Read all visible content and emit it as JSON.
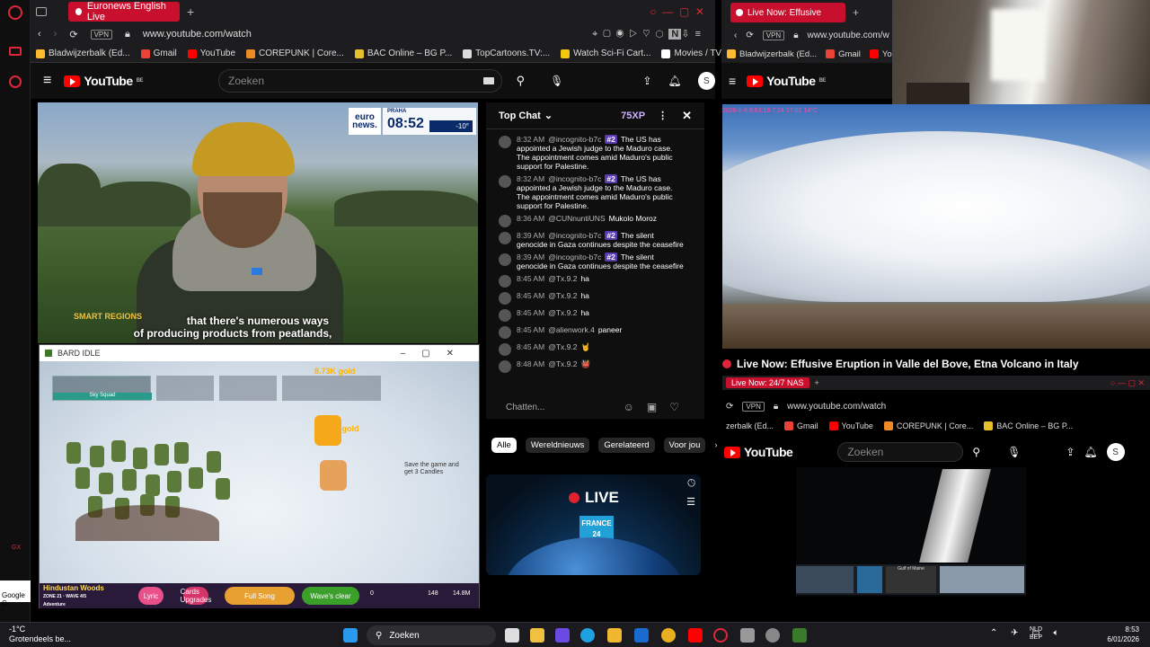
{
  "left_browser": {
    "tab_title": "Euronews English Live",
    "url": "www.youtube.com/watch",
    "vpn": "VPN",
    "bookmarks": [
      "Bladwijzerbalk (Ed...",
      "Gmail",
      "YouTube",
      "COREPUNK | Core...",
      "BAC Online – BG P...",
      "TopCartoons.TV:...",
      "Watch Sci-Fi Cart...",
      "Movies / TV / Ani..."
    ],
    "youtube": {
      "logo": "YouTube",
      "region": "BE",
      "search_placeholder": "Zoeken",
      "avatar": "S"
    },
    "video": {
      "euronews": "euro news.",
      "city": "PRAHA",
      "clock": "08:52",
      "temperature": "-10°",
      "subtitle_1": "that there's numerous ways",
      "subtitle_2": "of producing products from peatlands,",
      "logo_text": "SMART REGIONS"
    },
    "chat": {
      "header": "Top Chat",
      "xp": "75XP",
      "messages": [
        {
          "time": "8:32 AM",
          "author": "@incognito-b7c",
          "badge": "#2",
          "text": "The US has appointed a Jewish judge to the Maduro case. The appointment comes amid Maduro's public support for Palestine."
        },
        {
          "time": "8:32 AM",
          "author": "@incognito-b7c",
          "badge": "#2",
          "text": "The US has appointed a Jewish judge to the Maduro case. The appointment comes amid Maduro's public support for Palestine."
        },
        {
          "time": "8:36 AM",
          "author": "@CUNnuntiUNS",
          "badge": "",
          "text": "Mukolo Moroz"
        },
        {
          "time": "8:39 AM",
          "author": "@incognito-b7c",
          "badge": "#2",
          "text": "The silent genocide in Gaza continues despite the ceasefire"
        },
        {
          "time": "8:39 AM",
          "author": "@incognito-b7c",
          "badge": "#2",
          "text": "The silent genocide in Gaza continues despite the ceasefire"
        },
        {
          "time": "8:45 AM",
          "author": "@Tx.9.2",
          "badge": "",
          "text": "ha"
        },
        {
          "time": "8:45 AM",
          "author": "@Tx.9.2",
          "badge": "",
          "text": "ha"
        },
        {
          "time": "8:45 AM",
          "author": "@Tx.9.2",
          "badge": "",
          "text": "ha"
        },
        {
          "time": "8:45 AM",
          "author": "@alienwork.4",
          "badge": "",
          "text": "paneer"
        },
        {
          "time": "8:45 AM",
          "author": "@Tx.9.2",
          "badge": "",
          "text": "🤘"
        },
        {
          "time": "8:48 AM",
          "author": "@Tx.9.2",
          "badge": "",
          "text": "👹"
        }
      ],
      "input_placeholder": "Chatten..."
    },
    "categories": [
      "Alle",
      "Wereldnieuws",
      "Gerelateerd",
      "Voor jou"
    ],
    "live_card": {
      "live_label": "LIVE",
      "channel": "FRANCE 24"
    }
  },
  "bard_idle": {
    "title": "BARD IDLE",
    "squad": "Sky Squad",
    "gold_1": "8.73K gold",
    "gold_2": "8.75K gold",
    "banner": "Save the game and get 3 Candles",
    "location": "Hindustan Woods",
    "zone": "ZONE 21 · WAVE 4/5",
    "zone_sub": "Adventure",
    "buttons": [
      "Lyric",
      "Cards Upgrades",
      "Full Song",
      "Wave's clear"
    ],
    "counters": [
      "0",
      "148",
      "14.8M"
    ]
  },
  "right_browser": {
    "tab_title": "Live Now: Effusive",
    "url": "www.youtube.com/w",
    "bookmarks": [
      "Bladwijzerbalk (Ed...",
      "Gmail",
      "YouTube"
    ],
    "youtube": {
      "logo": "YouTube",
      "region": "BE"
    },
    "etna_overlay": "2026-1-6  8:53:19     7:24   17:02     14°C",
    "video_title": "Live Now: Effusive Eruption in Valle del Bove, Etna Volcano in Italy",
    "mini": {
      "tab_title": "Live Now: 24/7 NAS",
      "url": "www.youtube.com/watch",
      "bookmarks": [
        "zerbalk (Ed...",
        "Gmail",
        "YouTube",
        "COREPUNK | Core...",
        "BAC Online – BG P..."
      ],
      "search_placeholder": "Zoeken",
      "avatar": "S",
      "map_label": "Gulf of Maine"
    }
  },
  "taskbar": {
    "weather_temp": "-1°C",
    "weather_text": "Grotendeels be...",
    "search": "Zoeken",
    "lang_1": "NLD",
    "lang_2": "BEP",
    "time": "8:53",
    "date": "6/01/2026",
    "google": "Google C"
  },
  "colors": {
    "accent": "#c8102e",
    "youtube_red": "#ff0000",
    "chat_badge": "#5a3cb0"
  }
}
